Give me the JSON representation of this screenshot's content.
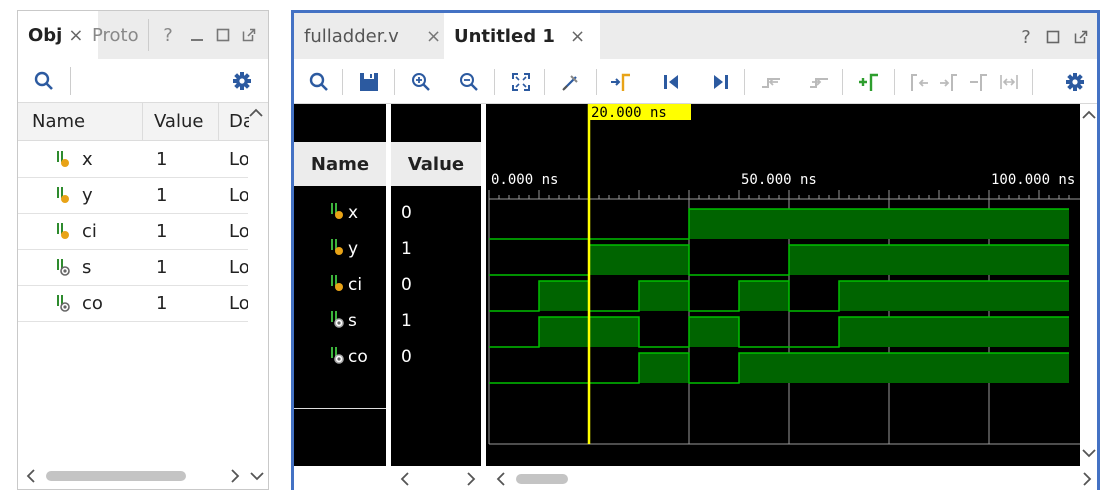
{
  "left_panel": {
    "tabs": [
      {
        "label": "Obj",
        "close": "×"
      },
      {
        "label": "Proto"
      }
    ],
    "window_controls": [
      "?",
      "minimize",
      "maximize",
      "float"
    ],
    "toolbar": [
      "search-icon",
      "gear-icon"
    ],
    "columns": [
      "Name",
      "Value",
      "Da"
    ],
    "rows": [
      {
        "name": "x",
        "value": "1",
        "data_type": "Lo",
        "icon": "input-port-icon"
      },
      {
        "name": "y",
        "value": "1",
        "data_type": "Lo",
        "icon": "input-port-icon"
      },
      {
        "name": "ci",
        "value": "1",
        "data_type": "Lo",
        "icon": "input-port-icon"
      },
      {
        "name": "s",
        "value": "1",
        "data_type": "Lo",
        "icon": "output-port-icon"
      },
      {
        "name": "co",
        "value": "1",
        "data_type": "Lo",
        "icon": "output-port-icon"
      }
    ]
  },
  "right_panel": {
    "tabs": [
      {
        "label": "fulladder.v",
        "close": "×"
      },
      {
        "label": "Untitled 1",
        "close": "×",
        "active": true
      }
    ],
    "window_controls": [
      "?",
      "maximize",
      "float"
    ],
    "toolbar": [
      "search-icon",
      "save-icon",
      "zoom-in-icon",
      "zoom-out-icon",
      "zoom-fit-icon",
      "snap-icon",
      "go-to-cursor-icon",
      "go-to-start-icon",
      "go-to-end-icon",
      "previous-transition-icon",
      "next-transition-icon",
      "add-marker-icon",
      "previous-marker-icon",
      "next-marker-icon",
      "swap-markers-icon",
      "delta-icon",
      "gear-icon"
    ],
    "name_header": "Name",
    "value_header": "Value",
    "signals": [
      {
        "name": "x",
        "value": "0",
        "icon": "input-port-icon"
      },
      {
        "name": "y",
        "value": "1",
        "icon": "input-port-icon"
      },
      {
        "name": "ci",
        "value": "0",
        "icon": "input-port-icon"
      },
      {
        "name": "s",
        "value": "1",
        "icon": "output-port-icon"
      },
      {
        "name": "co",
        "value": "0",
        "icon": "output-port-icon"
      }
    ],
    "timeline": {
      "cursor_label": "20.000 ns",
      "cursor_time_ns": 20,
      "tick_labels": [
        {
          "label": "0.000 ns",
          "time_ns": 0
        },
        {
          "label": "50.000 ns",
          "time_ns": 50
        },
        {
          "label": "100.000 ns",
          "time_ns": 100
        }
      ],
      "time_range_ns": [
        0,
        116
      ],
      "waveforms": [
        {
          "signal": "x",
          "transitions": [
            [
              0,
              0
            ],
            [
              40,
              1
            ]
          ]
        },
        {
          "signal": "y",
          "transitions": [
            [
              0,
              0
            ],
            [
              20,
              1
            ],
            [
              40,
              0
            ],
            [
              60,
              1
            ]
          ]
        },
        {
          "signal": "ci",
          "transitions": [
            [
              0,
              0
            ],
            [
              10,
              1
            ],
            [
              20,
              0
            ],
            [
              30,
              1
            ],
            [
              40,
              0
            ],
            [
              50,
              1
            ],
            [
              60,
              0
            ],
            [
              70,
              1
            ]
          ]
        },
        {
          "signal": "s",
          "transitions": [
            [
              0,
              0
            ],
            [
              10,
              1
            ],
            [
              30,
              0
            ],
            [
              40,
              1
            ],
            [
              50,
              0
            ],
            [
              70,
              1
            ]
          ]
        },
        {
          "signal": "co",
          "transitions": [
            [
              0,
              0
            ],
            [
              30,
              1
            ],
            [
              40,
              0
            ],
            [
              50,
              1
            ]
          ]
        }
      ]
    },
    "colors": {
      "wave": "#00c000",
      "wave_fill": "#006400",
      "cursor": "#ffff00",
      "grid": "#9a9a9a",
      "background": "#000000",
      "accent": "#4472c4"
    }
  }
}
